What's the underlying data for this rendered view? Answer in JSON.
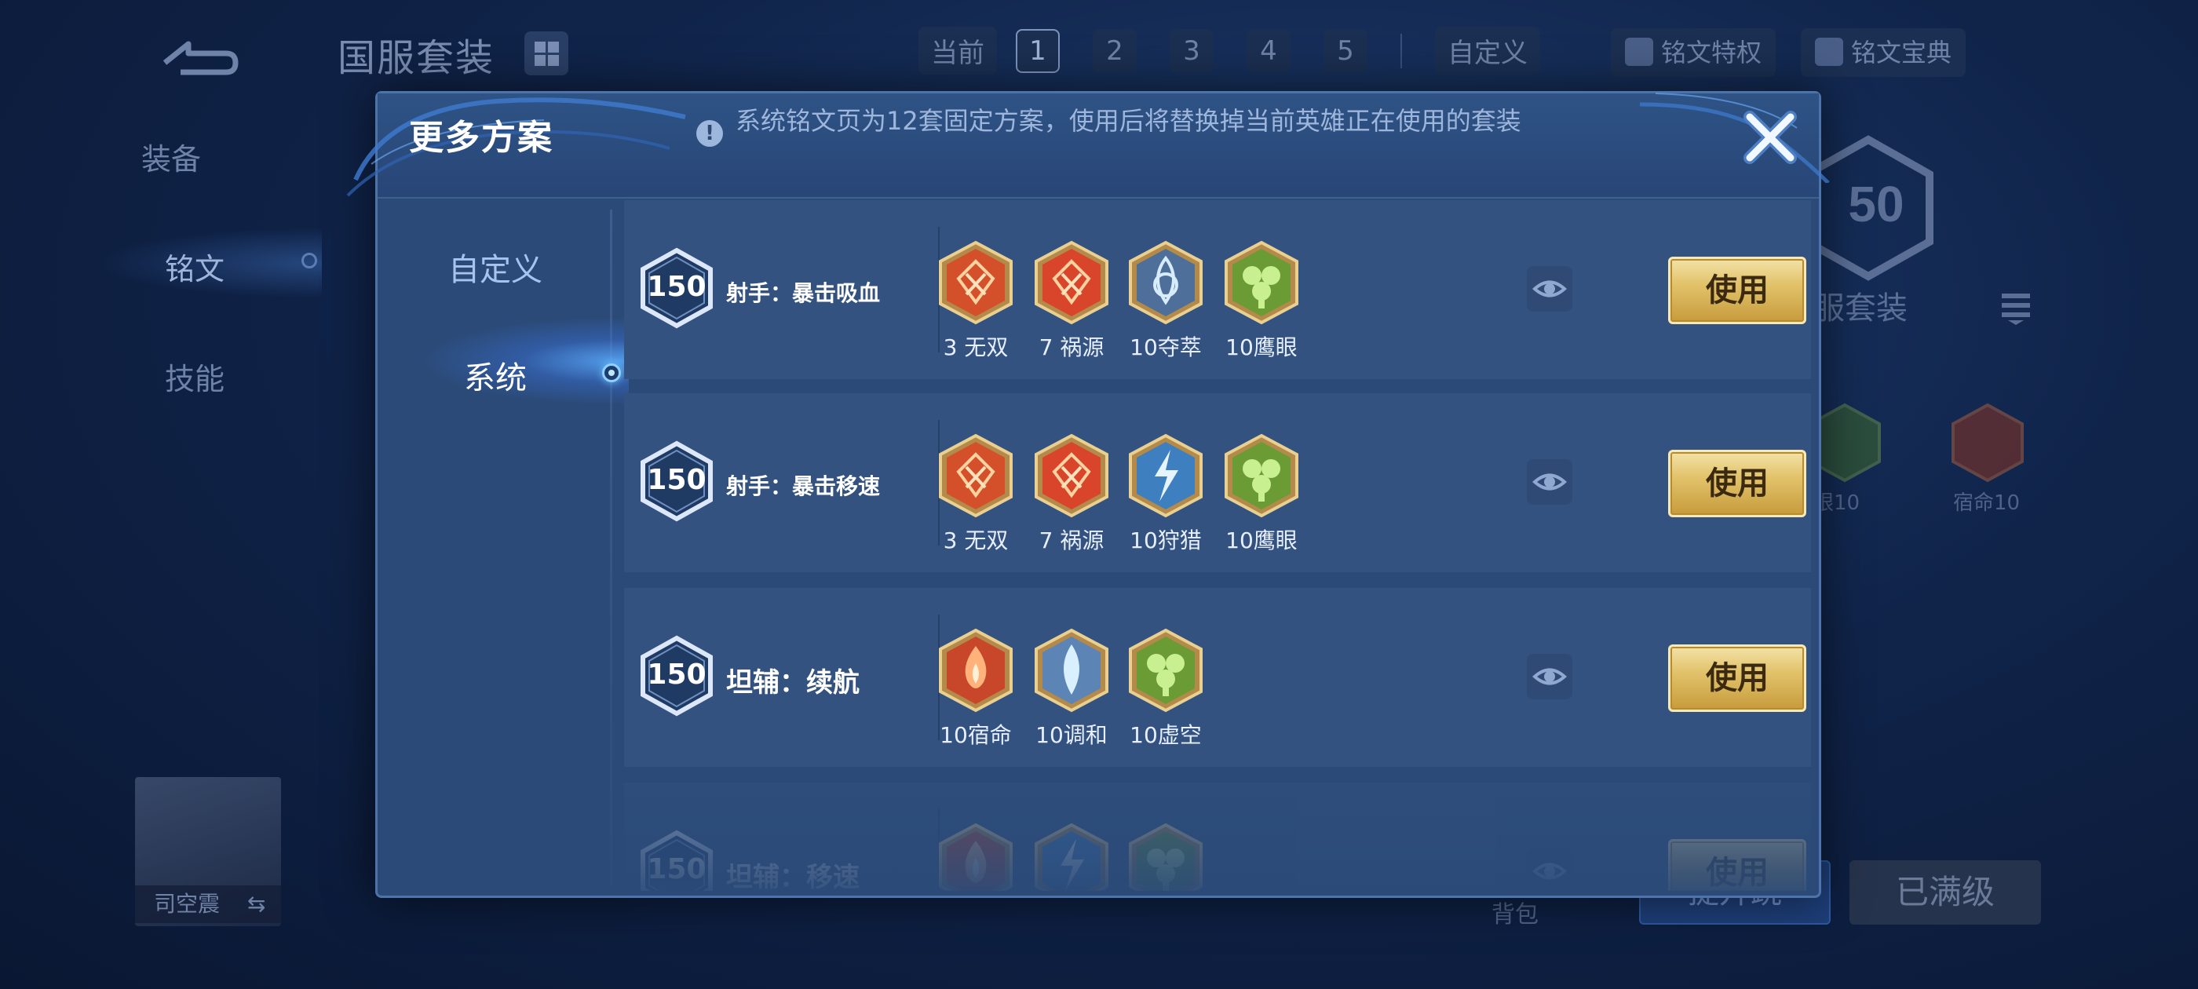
{
  "background": {
    "title": "国服套装",
    "nav": [
      "装备",
      "铭文",
      "技能"
    ],
    "current_label": "当前",
    "page_tabs": [
      "1",
      "2",
      "3",
      "4",
      "5"
    ],
    "custom_label": "自定义",
    "privilege_btn": "铭文特权",
    "handbook_btn": "铭文宝典",
    "hex_level": "50",
    "side_label": "服套装",
    "rune_labels": [
      "眼10",
      "宿命10"
    ],
    "hero_name": "司空震",
    "swap_icon": "⇆",
    "bag_label": "背包",
    "upgrade_btn": "提升跳",
    "maxed_btn": "已满级"
  },
  "modal": {
    "title": "更多方案",
    "notice": "系统铭文页为12套固定方案，使用后将替换掉当前英雄正在使用的套装",
    "sidebar": [
      "自定义",
      "系统"
    ],
    "active_sidebar": "系统",
    "use_label": "使用",
    "presets": [
      {
        "level": "150",
        "name": "射手：暴击吸血",
        "runes": [
          {
            "label": "3 无双",
            "icon": "crit-rune-icon",
            "color": "#d4502a"
          },
          {
            "label": "7 祸源",
            "icon": "crit-rune-icon",
            "color": "#d8452b"
          },
          {
            "label": "10夺萃",
            "icon": "lifesteal-rune-icon",
            "color": "#4d6f9a"
          },
          {
            "label": "10鹰眼",
            "icon": "eagle-eye-rune-icon",
            "color": "#6a9b35"
          }
        ]
      },
      {
        "level": "150",
        "name": "射手：暴击移速",
        "runes": [
          {
            "label": "3 无双",
            "icon": "crit-rune-icon",
            "color": "#d4502a"
          },
          {
            "label": "7 祸源",
            "icon": "crit-rune-icon",
            "color": "#d8452b"
          },
          {
            "label": "10狩猎",
            "icon": "hunt-rune-icon",
            "color": "#3d7fbf"
          },
          {
            "label": "10鹰眼",
            "icon": "eagle-eye-rune-icon",
            "color": "#6a9b35"
          }
        ]
      },
      {
        "level": "150",
        "name": "坦辅：续航",
        "runes": [
          {
            "label": "10宿命",
            "icon": "fate-rune-icon",
            "color": "#c8462a"
          },
          {
            "label": "10调和",
            "icon": "harmony-rune-icon",
            "color": "#5c84b5"
          },
          {
            "label": "10虚空",
            "icon": "void-rune-icon",
            "color": "#6a9b35"
          }
        ]
      },
      {
        "level": "150",
        "name": "坦辅：移速",
        "runes": [
          {
            "label": "",
            "icon": "fate-rune-icon",
            "color": "#c8462a"
          },
          {
            "label": "",
            "icon": "hunt-rune-icon",
            "color": "#3d7fbf"
          },
          {
            "label": "",
            "icon": "void-rune-icon",
            "color": "#6a9b35"
          }
        ]
      }
    ]
  }
}
